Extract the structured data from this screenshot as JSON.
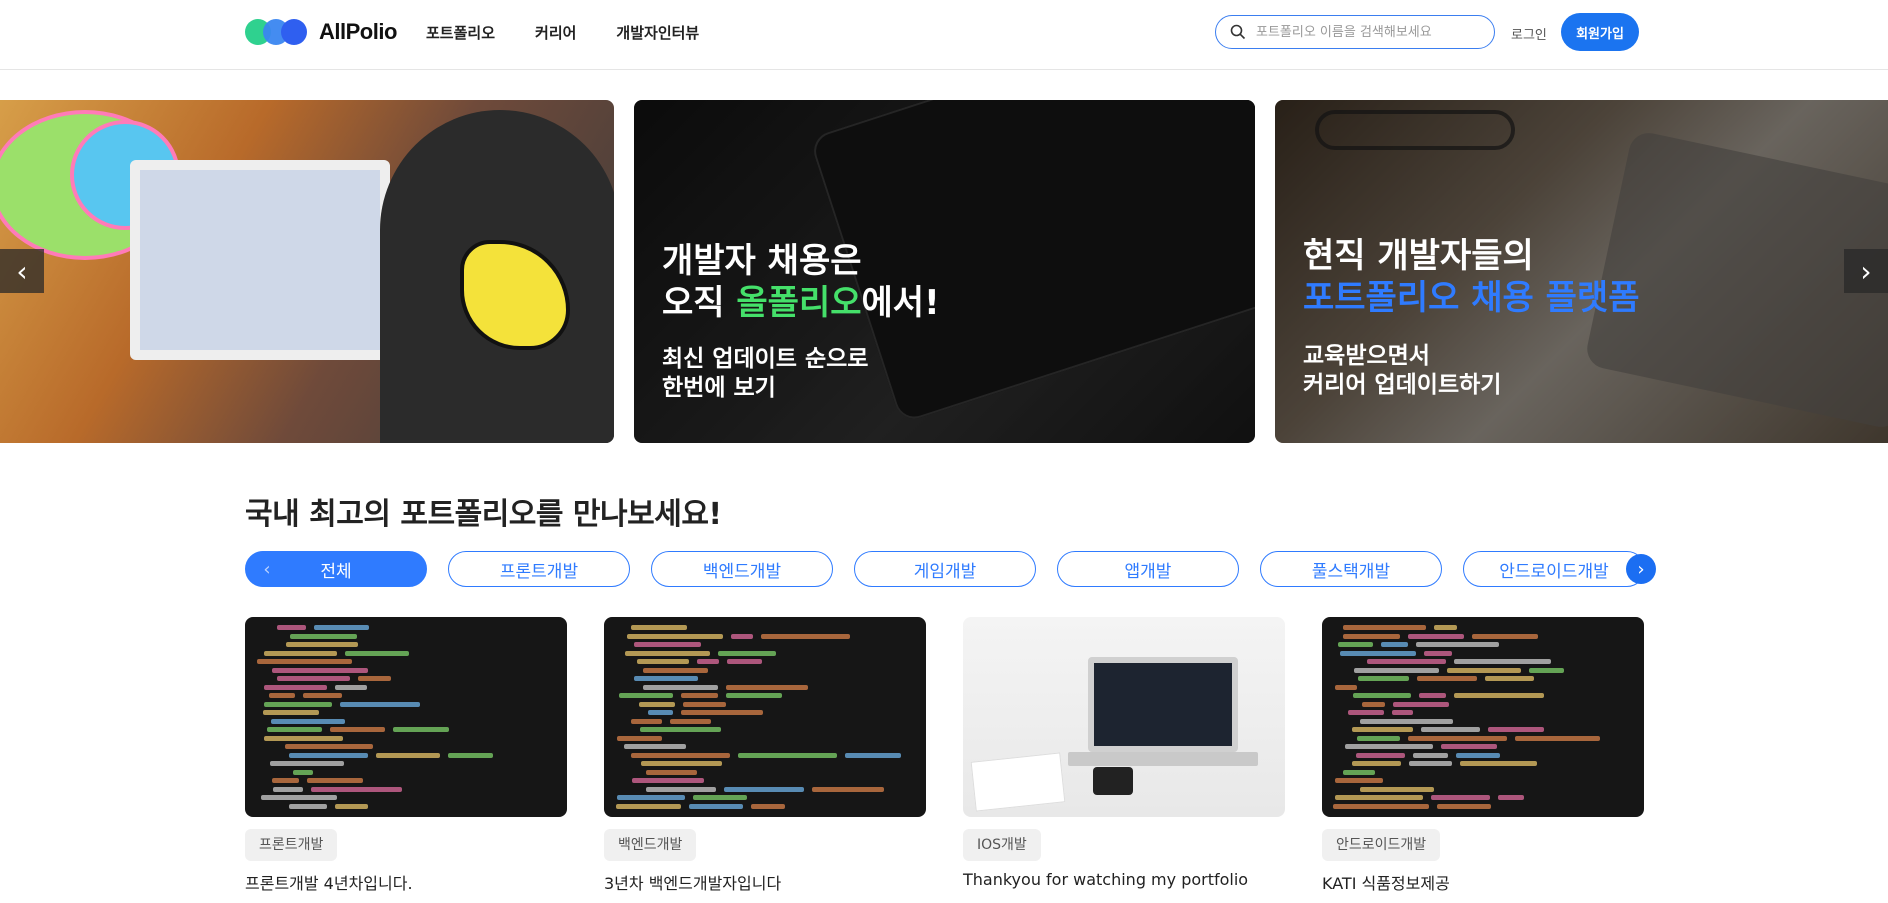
{
  "header": {
    "logo_text": "AllPolio",
    "nav": [
      "포트폴리오",
      "커리어",
      "개발자인터뷰"
    ],
    "search_placeholder": "포트폴리오 이름을 검색해보세요",
    "login_label": "로그인",
    "signup_label": "회원가입"
  },
  "banner": {
    "slide2": {
      "line1": "개발자 채용은",
      "line2_prefix": "오직 ",
      "line2_highlight": "올폴리오",
      "line2_suffix": "에서!",
      "sub1": "최신 업데이트 순으로",
      "sub2": "한번에 보기"
    },
    "slide3": {
      "line1": "현직 개발자들의",
      "line2_highlight": "포트폴리오 채용 플랫폼",
      "sub1": "교육받으면서",
      "sub2": "커리어 업데이트하기"
    },
    "prev_icon": "‹",
    "next_icon": "›"
  },
  "section": {
    "title": "국내 최고의 포트폴리오를 만나보세요!",
    "tabs": [
      "전체",
      "프론트개발",
      "백엔드개발",
      "게임개발",
      "앱개발",
      "풀스택개발",
      "안드로이드개발"
    ],
    "active_tab": "전체"
  },
  "cards": [
    {
      "category": "프론트개발",
      "title": "프론트개발 4년차입니다."
    },
    {
      "category": "백엔드개발",
      "title": "3년차 백엔드개발자입니다"
    },
    {
      "category": "IOS개발",
      "title": "Thankyou for watching my portfolio"
    },
    {
      "category": "안드로이드개발",
      "title": "KATI 식품정보제공"
    }
  ],
  "colors": {
    "accent": "#2f7bff",
    "signup": "#1b74f0",
    "highlight_green": "#45e06a",
    "highlight_blue": "#2f7bff"
  }
}
